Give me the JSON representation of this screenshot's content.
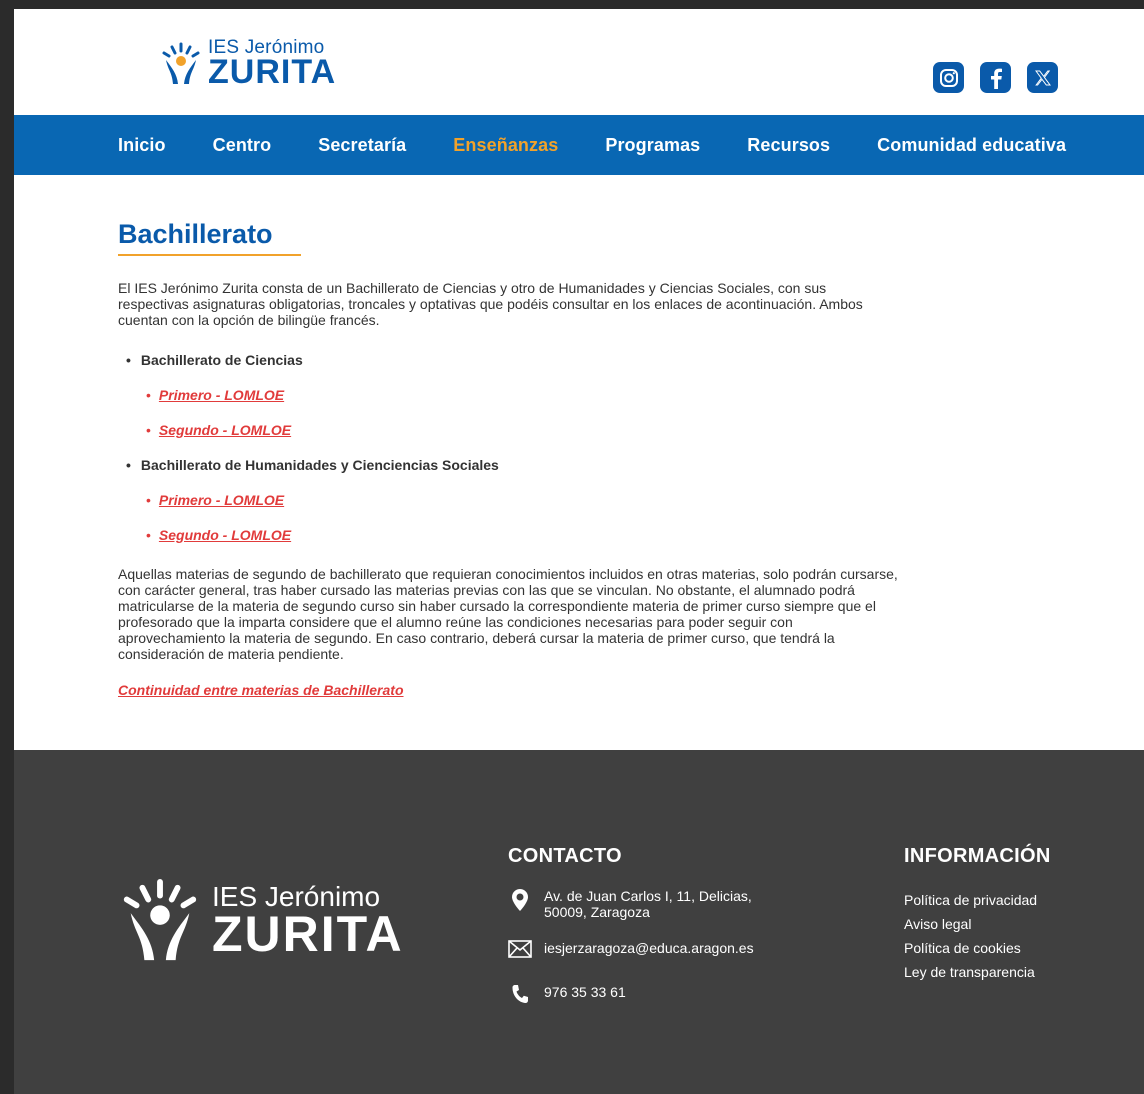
{
  "header": {
    "logo_small": "IES Jerónimo",
    "logo_big": "ZURITA",
    "social": [
      {
        "icon": "instagram-icon"
      },
      {
        "icon": "facebook-icon"
      },
      {
        "icon": "x-icon"
      }
    ]
  },
  "nav": {
    "items": [
      "Inicio",
      "Centro",
      "Secretaría",
      "Enseñanzas",
      "Programas",
      "Recursos",
      "Comunidad educativa"
    ],
    "active": "Enseñanzas",
    "active_color": "#f1a22b",
    "bg_color": "#0967b3"
  },
  "main": {
    "title": "Bachillerato",
    "intro": "El IES Jerónimo Zurita consta de un Bachillerato de Ciencias y otro de Humanidades y Ciencias Sociales, con sus respectivas asignaturas obligatorias, troncales y optativas que podéis consultar en los enlaces de acontinuación. Ambos cuentan con la opción de bilingüe francés.",
    "sections": [
      {
        "label": "Bachillerato de Ciencias",
        "links": [
          "Primero - LOMLOE",
          "Segundo - LOMLOE"
        ]
      },
      {
        "label": "Bachillerato de Humanidades y Cienciencias Sociales",
        "links": [
          "Primero - LOMLOE",
          "Segundo - LOMLOE"
        ]
      }
    ],
    "paragraph2": "Aquellas materias de segundo de bachillerato que requieran conocimientos incluidos en otras materias, solo podrán cursarse, con carácter general, tras haber cursado las materias previas con las que se vinculan. No obstante, el alumnado podrá matricularse de la materia de segundo curso sin haber cursado la correspondiente materia de primer curso siempre que el profesorado que la imparta considere que el alumno reúne las condiciones necesarias para poder seguir con aprovechamiento la materia de segundo. En caso contrario, deberá cursar la materia de primer curso, que tendrá la consideración de materia pendiente.",
    "continuity_link": "Continuidad entre materias de Bachillerato",
    "link_color": "#e13b3b"
  },
  "footer": {
    "logo_small": "IES Jerónimo",
    "logo_big": "ZURITA",
    "contact": {
      "heading": "CONTACTO",
      "address_line1": "Av. de Juan Carlos I, 11, Delicias,",
      "address_line2": "50009, Zaragoza",
      "email": "iesjerzaragoza@educa.aragon.es",
      "phone": "976 35 33 61"
    },
    "info": {
      "heading": "INFORMACIÓN",
      "links": [
        "Política de privacidad",
        "Aviso legal",
        "Política de cookies",
        "Ley de transparencia"
      ]
    },
    "bg_color": "#404040"
  }
}
